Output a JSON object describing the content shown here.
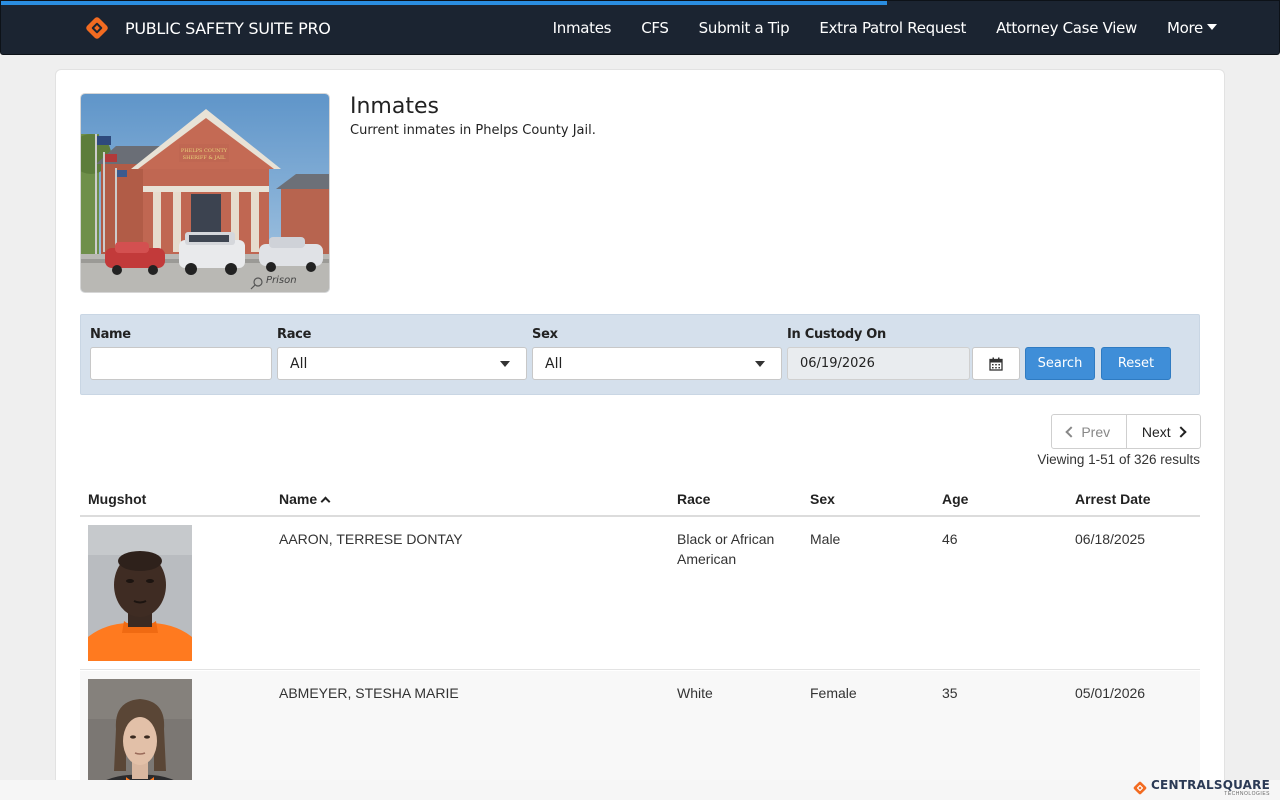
{
  "brand": {
    "name": "PUBLIC SAFETY SUITE PRO",
    "logo_icon": "centralsquare-diamond-icon"
  },
  "nav": {
    "items": [
      "Inmates",
      "CFS",
      "Submit a Tip",
      "Extra Patrol Request",
      "Attorney Case View"
    ],
    "more_label": "More"
  },
  "page": {
    "title": "Inmates",
    "subtitle": "Current inmates in Phelps County Jail.",
    "hero_caption": "Prison"
  },
  "filters": {
    "name_label": "Name",
    "name_value": "",
    "race_label": "Race",
    "race_value": "All",
    "sex_label": "Sex",
    "sex_value": "All",
    "custody_label": "In Custody On",
    "custody_value": "06/19/2026",
    "search_label": "Search",
    "reset_label": "Reset"
  },
  "pagination": {
    "prev_label": "Prev",
    "next_label": "Next",
    "viewing_text": "Viewing 1-51 of 326 results"
  },
  "table": {
    "headers": [
      "Mugshot",
      "Name",
      "Race",
      "Sex",
      "Age",
      "Arrest Date"
    ],
    "rows": [
      {
        "name": "AARON, TERRESE DONTAY",
        "race": "Black or African American",
        "sex": "Male",
        "age": "46",
        "arrest_date": "06/18/2025"
      },
      {
        "name": "ABMEYER, STESHA MARIE",
        "race": "White",
        "sex": "Female",
        "age": "35",
        "arrest_date": "05/01/2026"
      }
    ]
  },
  "footer": {
    "name": "CENTRALSQUARE",
    "sub": "TECHNOLOGIES"
  },
  "colors": {
    "nav_bg": "#1b2431",
    "accent": "#3f8ed8",
    "filter_bg": "#d5e0ec",
    "brand_orange": "#f26b21"
  }
}
